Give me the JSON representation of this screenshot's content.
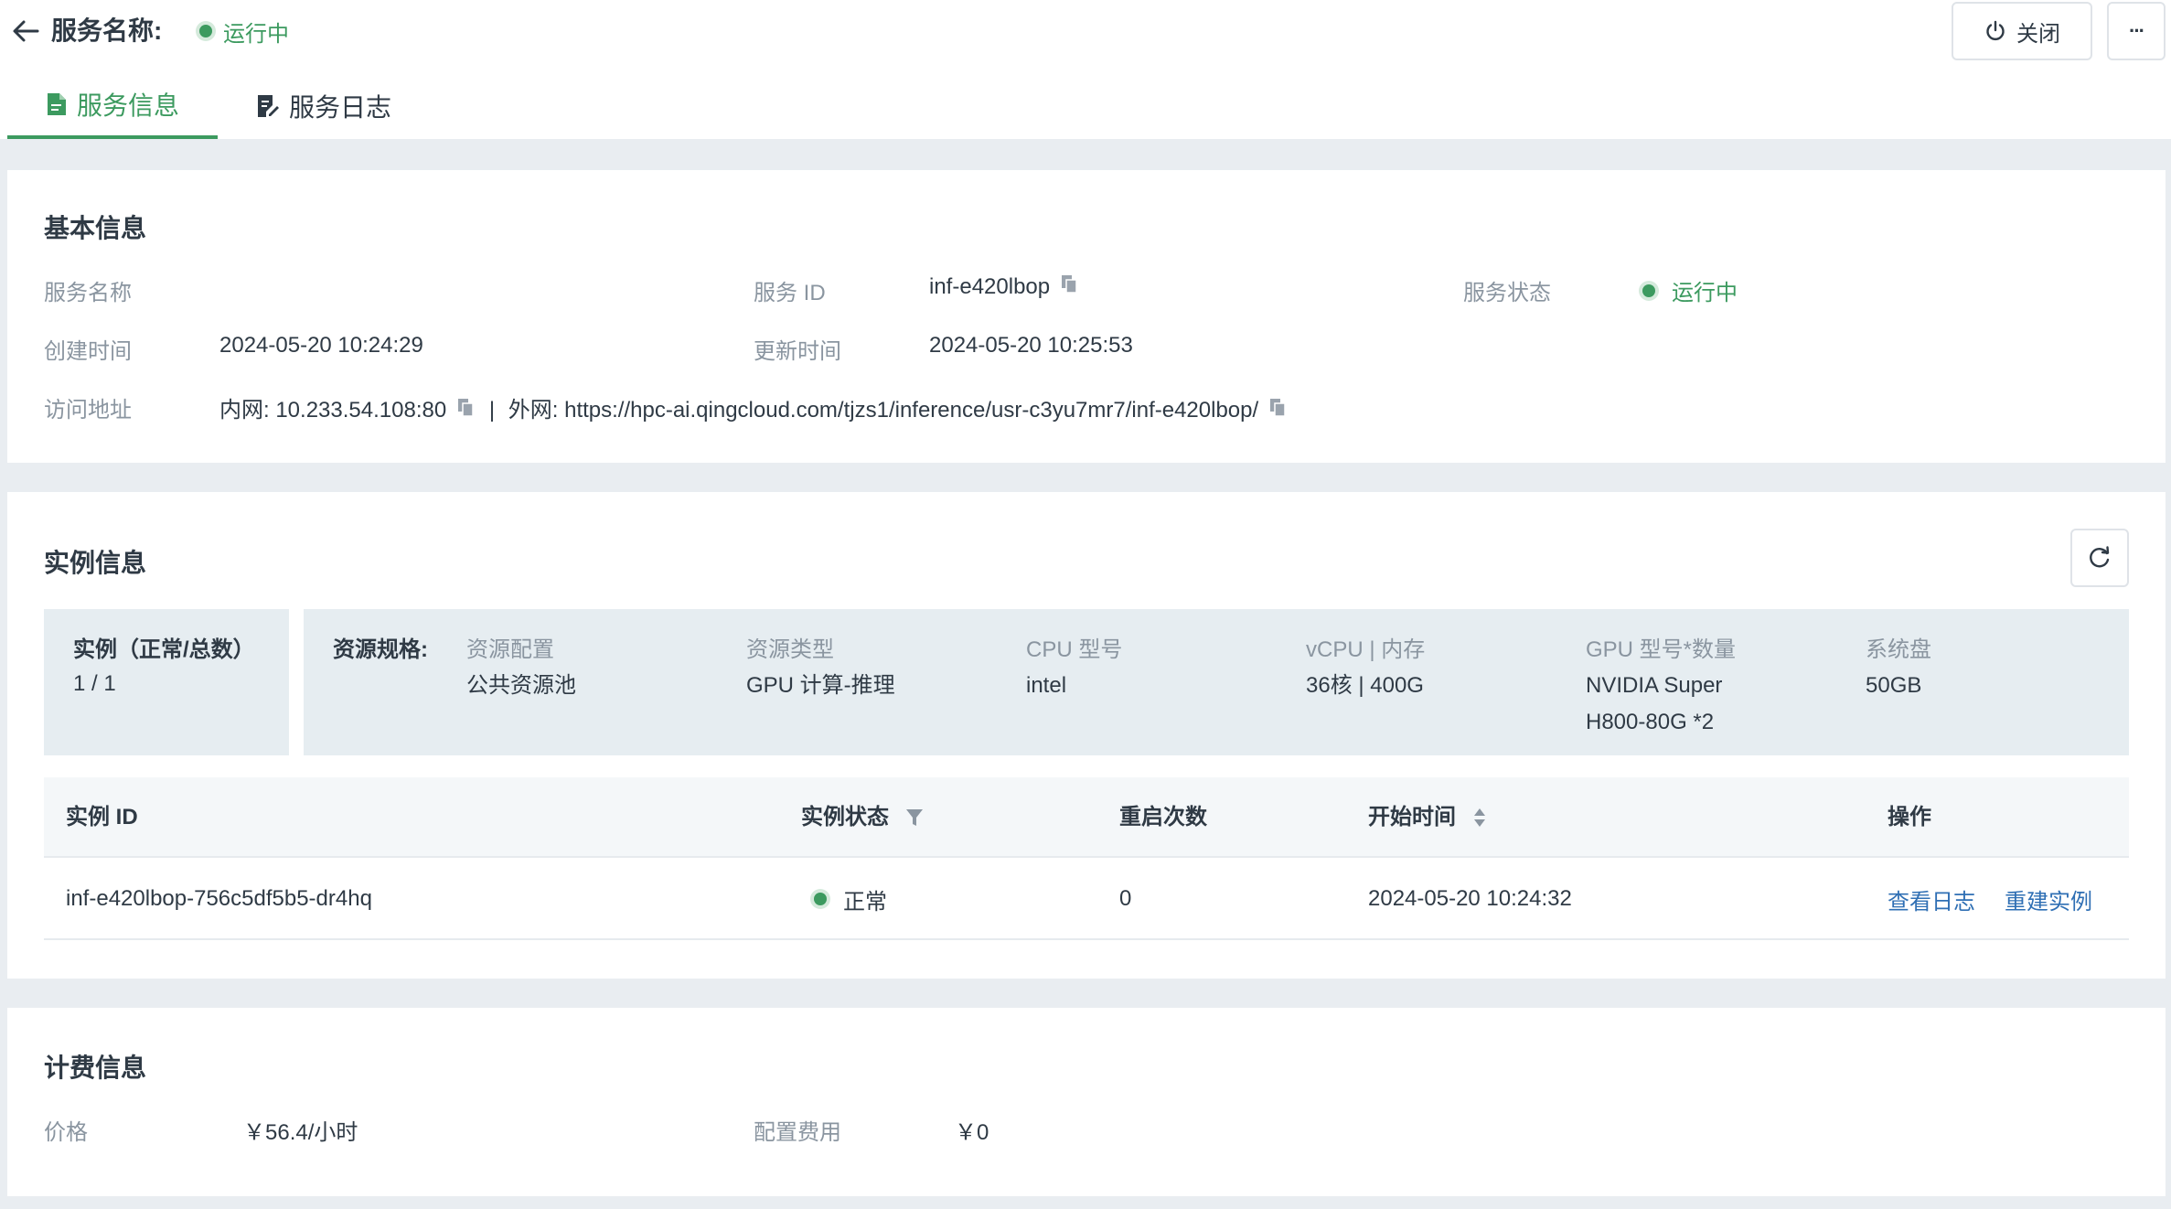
{
  "header": {
    "title": "服务名称:",
    "status": "运行中",
    "close_label": "关闭",
    "more_label": "···"
  },
  "tabs": [
    {
      "label": "服务信息",
      "active": true
    },
    {
      "label": "服务日志",
      "active": false
    }
  ],
  "basic": {
    "title": "基本信息",
    "service_name_label": "服务名称",
    "service_name_value": "",
    "service_id_label": "服务 ID",
    "service_id_value": "inf-e420lbop",
    "service_status_label": "服务状态",
    "service_status_value": "运行中",
    "created_label": "创建时间",
    "created_value": "2024-05-20 10:24:29",
    "updated_label": "更新时间",
    "updated_value": "2024-05-20 10:25:53",
    "address_label": "访问地址",
    "internal_address": "内网: 10.233.54.108:80",
    "separator": "|",
    "external_address": "外网: https://hpc-ai.qingcloud.com/tjzs1/inference/usr-c3yu7mr7/inf-e420lbop/"
  },
  "instance": {
    "title": "实例信息",
    "summary_title": "实例（正常/总数）",
    "summary_value": "1 / 1",
    "spec_title": "资源规格:",
    "specs": [
      {
        "label": "资源配置",
        "value": "公共资源池"
      },
      {
        "label": "资源类型",
        "value": "GPU 计算-推理"
      },
      {
        "label": "CPU 型号",
        "value": "intel"
      },
      {
        "label": "vCPU | 内存",
        "value": "36核 | 400G"
      },
      {
        "label": "GPU 型号*数量",
        "value": "NVIDIA Super H800-80G *2"
      },
      {
        "label": "系统盘",
        "value": "50GB"
      }
    ],
    "table": {
      "headers": {
        "id": "实例 ID",
        "status": "实例状态",
        "restarts": "重启次数",
        "start_time": "开始时间",
        "actions": "操作"
      },
      "rows": [
        {
          "id": "inf-e420lbop-756c5df5b5-dr4hq",
          "status": "正常",
          "restarts": "0",
          "start_time": "2024-05-20 10:24:32",
          "action_logs": "查看日志",
          "action_rebuild": "重建实例"
        }
      ]
    }
  },
  "billing": {
    "title": "计费信息",
    "price_label": "价格",
    "price_value": "￥56.4/小时",
    "config_fee_label": "配置费用",
    "config_fee_value": "￥0"
  },
  "colors": {
    "accent_green": "#3c9a5f",
    "link_blue": "#2f6fb4",
    "label_gray": "#8a95a0"
  }
}
